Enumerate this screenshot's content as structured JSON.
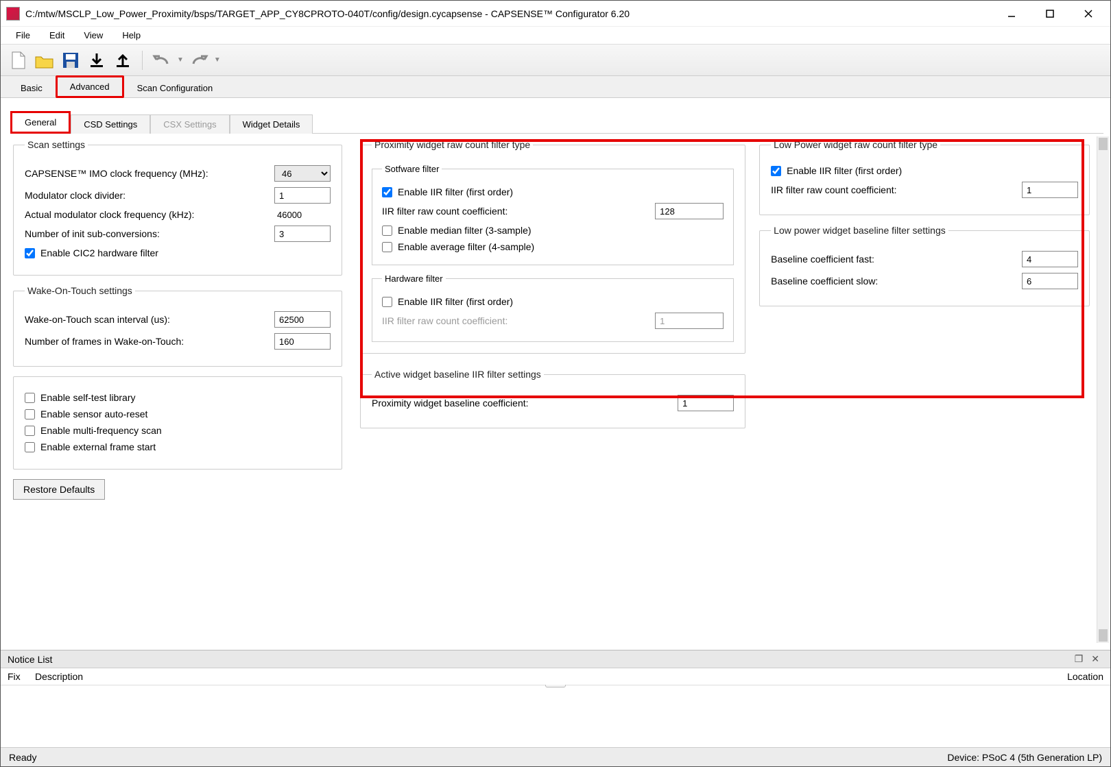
{
  "window": {
    "title": "C:/mtw/MSCLP_Low_Power_Proximity/bsps/TARGET_APP_CY8CPROTO-040T/config/design.cycapsense - CAPSENSE™ Configurator 6.20"
  },
  "menu": {
    "file": "File",
    "edit": "Edit",
    "view": "View",
    "help": "Help"
  },
  "main_tabs": {
    "basic": "Basic",
    "advanced": "Advanced",
    "scan_config": "Scan Configuration"
  },
  "sub_tabs": {
    "general": "General",
    "csd": "CSD Settings",
    "csx": "CSX Settings",
    "widget": "Widget Details"
  },
  "scan_settings": {
    "legend": "Scan settings",
    "imo_label": "CAPSENSE™ IMO clock frequency (MHz):",
    "imo_value": "46",
    "mod_div_label": "Modulator clock divider:",
    "mod_div_value": "1",
    "actual_label": "Actual modulator clock frequency (kHz):",
    "actual_value": "46000",
    "init_subconv_label": "Number of init sub-conversions:",
    "init_subconv_value": "3",
    "cic2_label": "Enable CIC2 hardware filter"
  },
  "wot": {
    "legend": "Wake-On-Touch settings",
    "interval_label": "Wake-on-Touch scan interval (us):",
    "interval_value": "62500",
    "frames_label": "Number of frames in Wake-on-Touch:",
    "frames_value": "160"
  },
  "misc": {
    "self_test": "Enable self-test library",
    "auto_reset": "Enable sensor auto-reset",
    "multi_freq": "Enable multi-frequency scan",
    "ext_frame": "Enable external frame start"
  },
  "restore": "Restore Defaults",
  "prox": {
    "legend": "Proximity widget raw count filter type",
    "sw_legend": "Sotfware filter",
    "iir_label": "Enable IIR filter (first order)",
    "iir_coef_label": "IIR filter raw count coefficient:",
    "iir_coef_value": "128",
    "median_label": "Enable median filter (3-sample)",
    "avg_label": "Enable average filter (4-sample)",
    "hw_legend": "Hardware filter",
    "hw_iir_label": "Enable IIR filter (first order)",
    "hw_iir_coef_label": "IIR filter raw count coefficient:",
    "hw_iir_coef_value": "1"
  },
  "lp_filter": {
    "legend": "Low Power widget raw count filter type",
    "iir_label": "Enable IIR filter (first order)",
    "iir_coef_label": "IIR filter raw count coefficient:",
    "iir_coef_value": "1"
  },
  "lp_baseline": {
    "legend": "Low power widget baseline filter settings",
    "fast_label": "Baseline coefficient fast:",
    "fast_value": "4",
    "slow_label": "Baseline coefficient slow:",
    "slow_value": "6"
  },
  "active_baseline": {
    "legend": "Active widget baseline IIR filter settings",
    "prox_label": "Proximity widget baseline coefficient:",
    "prox_value": "1"
  },
  "notice": {
    "title": "Notice List",
    "fix": "Fix",
    "description": "Description",
    "location": "Location"
  },
  "status": {
    "ready": "Ready",
    "device": "Device: PSoC 4 (5th Generation LP)"
  }
}
